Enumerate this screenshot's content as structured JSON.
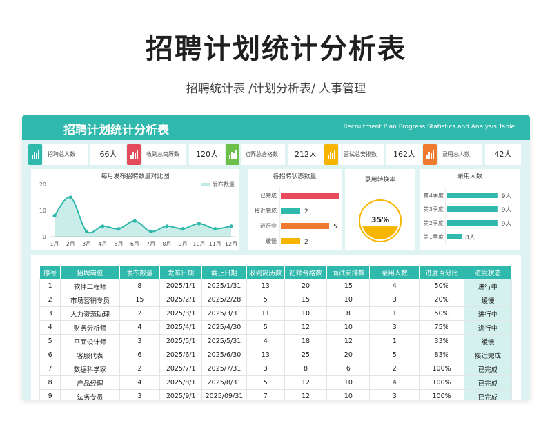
{
  "title": "招聘计划统计分析表",
  "subtitle": "招聘统计表 /计划分析表/ 人事管理",
  "banner": {
    "title": "招聘计划统计分析表",
    "en_title": "Recruitment Plan Progress Statistics and Analysis Table"
  },
  "kpis": [
    {
      "label": "招聘总人数",
      "value": "66人",
      "color": "#2fb8ac",
      "icon": "bar-chart-icon"
    },
    {
      "label": "收到总简历数",
      "value": "120人",
      "color": "#e54b5b",
      "icon": "bar-chart-icon"
    },
    {
      "label": "初筛总合格数",
      "value": "212人",
      "color": "#6cc04a",
      "icon": "bar-chart-icon"
    },
    {
      "label": "面试总安排数",
      "value": "162人",
      "color": "#f7b500",
      "icon": "bar-chart-icon"
    },
    {
      "label": "录用总人数",
      "value": "42人",
      "color": "#ee7b2f",
      "icon": "bar-chart-icon"
    }
  ],
  "chart_data": [
    {
      "type": "area",
      "title": "每月发布招聘数量对比图",
      "legend": "发布数量",
      "legend_position": "top-right",
      "categories": [
        "1月",
        "2月",
        "3月",
        "4月",
        "5月",
        "6月",
        "7月",
        "8月",
        "9月",
        "10月",
        "11月",
        "12月"
      ],
      "values": [
        8,
        15,
        2,
        4,
        3,
        6,
        2,
        4,
        3,
        5,
        3,
        4
      ],
      "ylim": [
        0,
        20
      ],
      "yticks": [
        "0",
        "10",
        "20"
      ],
      "color": "#2fb8ac"
    },
    {
      "type": "bar",
      "title": "各招聘状态数量",
      "categories": [
        "已完成",
        "接近完成",
        "进行中",
        "缓慢"
      ],
      "values": [
        6,
        2,
        5,
        2
      ],
      "colors": [
        "#e54b5b",
        "#2fb8ac",
        "#ee7b2f",
        "#f7b500"
      ]
    },
    {
      "type": "pie",
      "title": "录用转换率",
      "value_label": "35%",
      "value": 0.35,
      "color": "#f7b500"
    },
    {
      "type": "bar",
      "title": "录用人数",
      "categories": [
        "第4季度",
        "第3季度",
        "第2季度",
        "第1季度"
      ],
      "values": [
        9,
        9,
        9,
        8
      ],
      "labels": [
        "9人",
        "9人",
        "9人",
        "8人"
      ],
      "color": "#2fb8ac"
    }
  ],
  "table": {
    "headers": [
      "序号",
      "招聘岗位",
      "发布数量",
      "发布日期",
      "截止日期",
      "收到简历数",
      "初筛合格数",
      "面试安排数",
      "录用人数",
      "进度百分比",
      "进度状态"
    ],
    "rows": [
      [
        "1",
        "软件工程师",
        "8",
        "2025/1/1",
        "2025/1/31",
        "13",
        "20",
        "15",
        "4",
        "50%",
        "进行中"
      ],
      [
        "2",
        "市场营销专员",
        "15",
        "2025/2/1",
        "2025/2/28",
        "5",
        "15",
        "10",
        "3",
        "20%",
        "缓慢"
      ],
      [
        "3",
        "人力资源助理",
        "2",
        "2025/3/1",
        "2025/3/31",
        "11",
        "10",
        "8",
        "1",
        "50%",
        "进行中"
      ],
      [
        "4",
        "财务分析师",
        "4",
        "2025/4/1",
        "2025/4/30",
        "5",
        "12",
        "10",
        "3",
        "75%",
        "进行中"
      ],
      [
        "5",
        "平面设计师",
        "3",
        "2025/5/1",
        "2025/5/31",
        "4",
        "18",
        "12",
        "1",
        "33%",
        "缓慢"
      ],
      [
        "6",
        "客服代表",
        "6",
        "2025/6/1",
        "2025/6/30",
        "13",
        "25",
        "20",
        "5",
        "83%",
        "接近完成"
      ],
      [
        "7",
        "数据科学家",
        "2",
        "2025/7/1",
        "2025/7/31",
        "3",
        "8",
        "6",
        "2",
        "100%",
        "已完成"
      ],
      [
        "8",
        "产品经理",
        "4",
        "2025/8/1",
        "2025/8/31",
        "5",
        "12",
        "10",
        "4",
        "100%",
        "已完成"
      ],
      [
        "9",
        "法务专员",
        "3",
        "2025/9/1",
        "2025/09/31",
        "7",
        "12",
        "10",
        "3",
        "100%",
        "已完成"
      ]
    ]
  }
}
